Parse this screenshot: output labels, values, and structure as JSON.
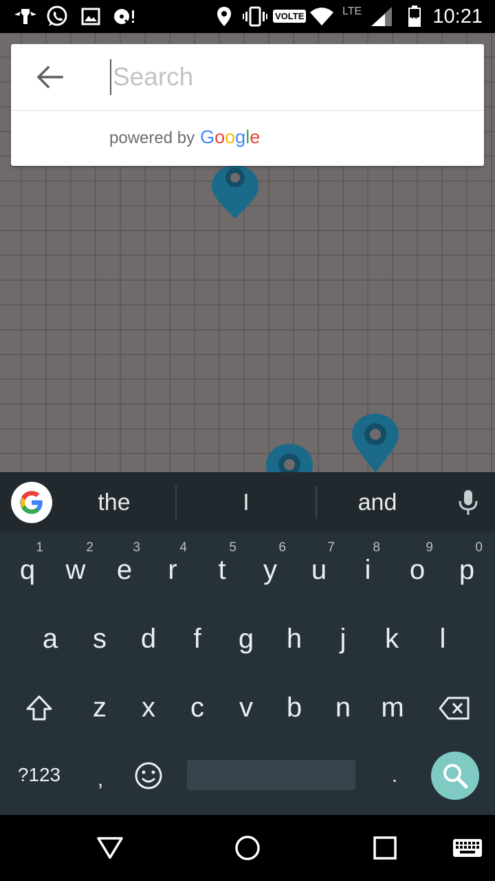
{
  "status_bar": {
    "time": "10:21",
    "volte": "VOLTE",
    "network": "LTE",
    "battery_level": "40",
    "icons": [
      "usb-debug-icon",
      "whatsapp-icon",
      "gallery-icon",
      "music-icon",
      "location-icon",
      "vibrate-icon",
      "volte-icon",
      "wifi-icon",
      "lte-icon",
      "signal-icon",
      "battery-icon"
    ]
  },
  "search": {
    "placeholder": "Search",
    "value": "",
    "powered_by": "powered by",
    "brand": [
      "G",
      "o",
      "o",
      "g",
      "l",
      "e"
    ],
    "brand_colors": [
      "#4285F4",
      "#EA4335",
      "#FBBC05",
      "#4285F4",
      "#34A853",
      "#EA4335"
    ]
  },
  "map": {
    "pin_color": "#1b6a8a",
    "background": "#6f6b6a"
  },
  "keyboard": {
    "suggestions": [
      "the",
      "I",
      "and"
    ],
    "row1": [
      "q",
      "w",
      "e",
      "r",
      "t",
      "y",
      "u",
      "i",
      "o",
      "p"
    ],
    "row1_hints": [
      "1",
      "2",
      "3",
      "4",
      "5",
      "6",
      "7",
      "8",
      "9",
      "0"
    ],
    "row2": [
      "a",
      "s",
      "d",
      "f",
      "g",
      "h",
      "j",
      "k",
      "l"
    ],
    "row3": [
      "z",
      "x",
      "c",
      "v",
      "b",
      "n",
      "m"
    ],
    "symbols_key": "?123",
    "comma": ",",
    "period": ".",
    "action_color": "#7fcbc4"
  },
  "nav_bar": {
    "buttons": [
      "back-icon",
      "home-icon",
      "recents-icon",
      "keyboard-switch-icon"
    ]
  }
}
